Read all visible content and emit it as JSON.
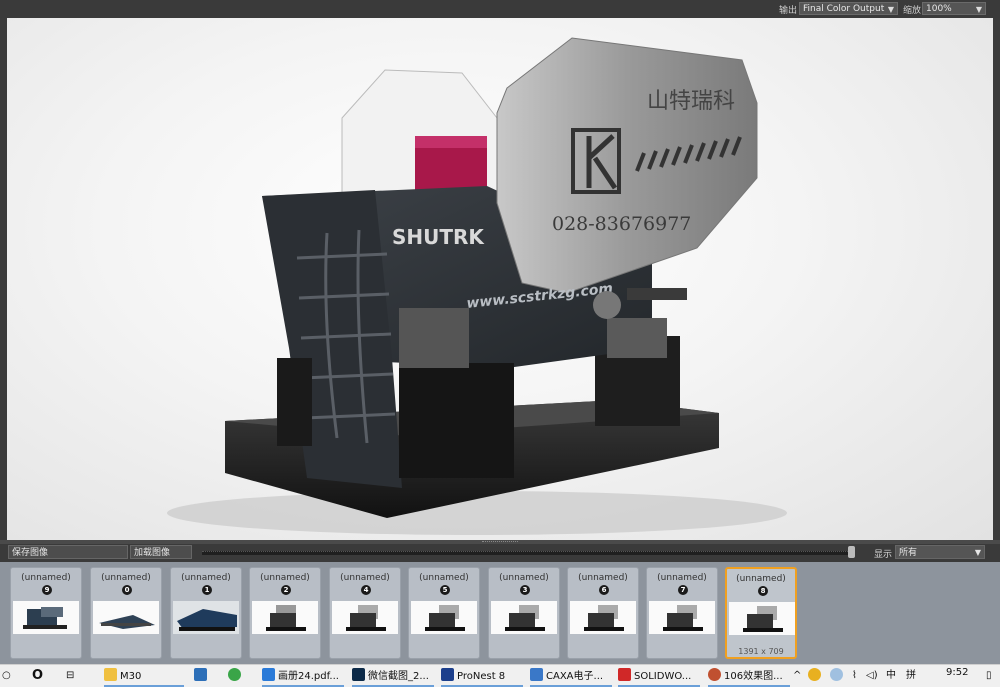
{
  "toolbar": {
    "output_label": "输出",
    "output_value": "Final Color Output",
    "zoom_label": "缩放",
    "zoom_value": "100%"
  },
  "render": {
    "logo_text": "SHUTRK",
    "chinese_name": "山特瑞科",
    "phone": "028-83676977",
    "website": "www.scstrkzg.com"
  },
  "controls": {
    "save_label": "保存图像",
    "load_label": "加载图像",
    "show_label": "显示",
    "show_value": "所有"
  },
  "thumbnails": [
    {
      "name": "(unnamed)",
      "number": "9"
    },
    {
      "name": "(unnamed)",
      "number": "0"
    },
    {
      "name": "(unnamed)",
      "number": "1"
    },
    {
      "name": "(unnamed)",
      "number": "2"
    },
    {
      "name": "(unnamed)",
      "number": "4"
    },
    {
      "name": "(unnamed)",
      "number": "5"
    },
    {
      "name": "(unnamed)",
      "number": "3"
    },
    {
      "name": "(unnamed)",
      "number": "6"
    },
    {
      "name": "(unnamed)",
      "number": "7"
    },
    {
      "name": "(unnamed)",
      "number": "8",
      "size": "1391 x 709",
      "selected": true
    }
  ],
  "taskbar": {
    "items": [
      {
        "label": "M30"
      },
      {
        "label": "画册24.pdf..."
      },
      {
        "label": "微信截图_2..."
      },
      {
        "label": "ProNest 8"
      },
      {
        "label": "CAXA电子..."
      },
      {
        "label": "SOLIDWO..."
      },
      {
        "label": "106效果图..."
      }
    ],
    "ime": "中",
    "ime2": "拼",
    "time": "9:52"
  },
  "colors": {
    "accent": "#f0a020",
    "thumb_bg": "#8d949d",
    "toolbar_bg": "#3a3a3a"
  }
}
